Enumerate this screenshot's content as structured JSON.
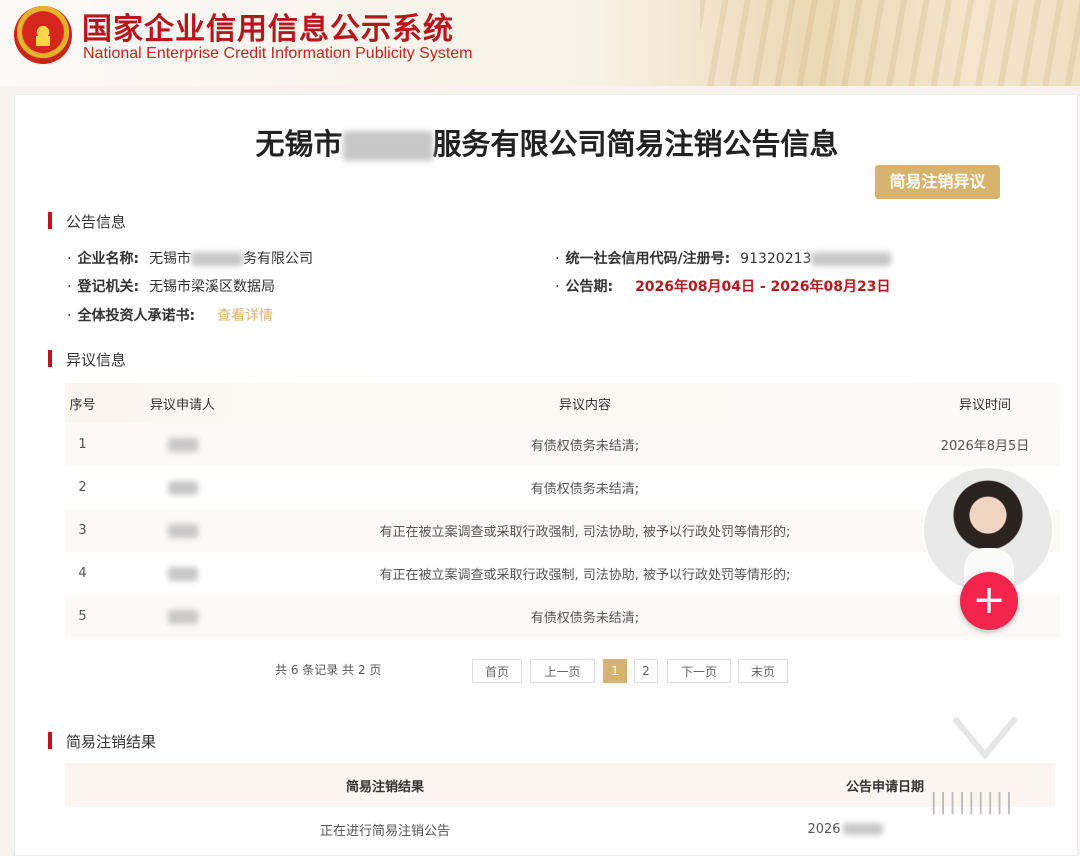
{
  "header": {
    "title_cn": "国家企业信用信息公示系统",
    "title_en": "National Enterprise Credit Information Publicity System"
  },
  "page": {
    "title_prefix": "无锡市",
    "title_suffix": "服务有限公司简易注销公告信息",
    "objection_button": "简易注销异议"
  },
  "announcement": {
    "section_title": "公告信息",
    "company_label": "企业名称:",
    "company_prefix": "无锡市",
    "company_suffix": "务有限公司",
    "credit_label": "统一社会信用代码/注册号:",
    "credit_value": "91320213",
    "authority_label": "登记机关:",
    "authority_value": "无锡市梁溪区数据局",
    "period_label": "公告期:",
    "period_value": "2026年08月04日 - 2026年08月23日",
    "commitment_label": "全体投资人承诺书:",
    "commitment_link": "查看详情"
  },
  "objections": {
    "section_title": "异议信息",
    "columns": [
      "序号",
      "异议申请人",
      "异议内容",
      "异议时间"
    ],
    "rows": [
      {
        "no": "1",
        "content": "有债权债务未结清;",
        "time": "2026年8月5日"
      },
      {
        "no": "2",
        "content": "有债权债务未结清;",
        "time": ""
      },
      {
        "no": "3",
        "content": "有正在被立案调查或采取行政强制, 司法协助, 被予以行政处罚等情形的;",
        "time": ""
      },
      {
        "no": "4",
        "content": "有正在被立案调查或采取行政强制, 司法协助, 被予以行政处罚等情形的;",
        "time": ""
      },
      {
        "no": "5",
        "content": "有债权债务未结清;",
        "time": "2026"
      }
    ]
  },
  "pager": {
    "summary": "共 6 条记录 共 2 页",
    "first": "首页",
    "prev": "上一页",
    "page1": "1",
    "page2": "2",
    "next": "下一页",
    "last": "末页"
  },
  "result": {
    "section_title": "简易注销结果",
    "col_result": "简易注销结果",
    "col_date": "公告申请日期",
    "row_result": "正在进行简易注销公告",
    "row_date": "2026"
  },
  "colors": {
    "brand_red": "#b8161c",
    "gold": "#d7b36e",
    "plus_button": "#f4244c"
  }
}
